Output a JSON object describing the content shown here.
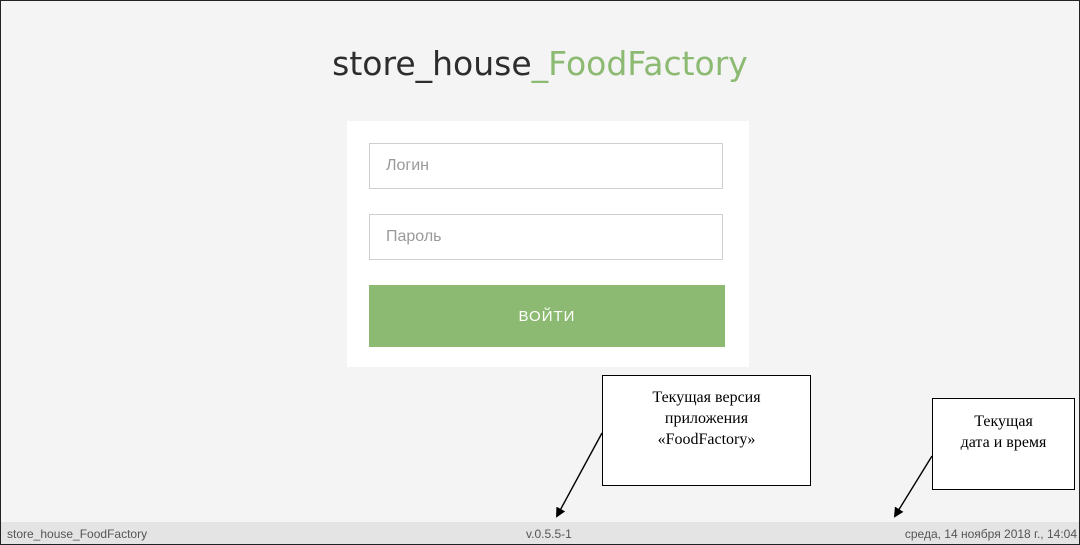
{
  "header": {
    "title_main": "store_house",
    "title_accent": "_FoodFactory"
  },
  "login_form": {
    "login_placeholder": "Логин",
    "password_placeholder": "Пароль",
    "submit_label": "ВОЙТИ"
  },
  "callouts": {
    "version": [
      "Текущая версия",
      "приложения",
      "«FoodFactory»"
    ],
    "datetime": [
      "Текущая",
      "дата и время"
    ]
  },
  "status_bar": {
    "app_name": "store_house_FoodFactory",
    "version": "v.0.5.5-1",
    "datetime": "среда, 14 ноября 2018 г., 14:04"
  },
  "colors": {
    "accent": "#8dba72",
    "background": "#f4f4f4"
  }
}
